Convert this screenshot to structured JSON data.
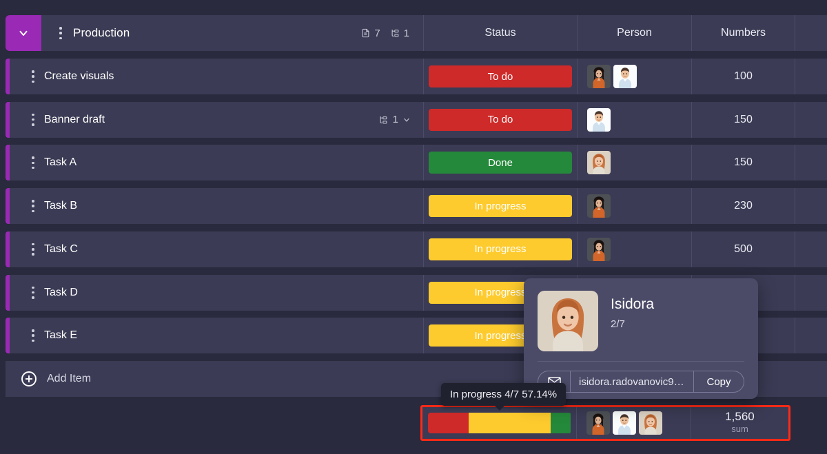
{
  "group": {
    "name": "Production",
    "toggle_icon": "chevron-down-icon",
    "drag_icon": "drag-handle-icon",
    "accent_color": "#9a29b5",
    "counts": {
      "items_icon": "document-icon",
      "items": "7",
      "subitems_icon": "subitem-tree-icon",
      "subitems": "1"
    }
  },
  "columns": {
    "name": "",
    "status": "Status",
    "person": "Person",
    "numbers": "Numbers"
  },
  "status_colors": {
    "To do": "#ce2a29",
    "Done": "#24893a",
    "In progress": "#fdcb2e"
  },
  "rows": [
    {
      "menu_icon": "kebab-menu-icon",
      "name": "Create visuals",
      "status": "To do",
      "avatars": [
        "woman-dark-hair-orange",
        "man-light-shirt"
      ],
      "number": "100",
      "subitems": null
    },
    {
      "menu_icon": "kebab-menu-icon",
      "name": "Banner draft",
      "status": "To do",
      "avatars": [
        "man-light-shirt"
      ],
      "number": "150",
      "subitems": "1",
      "subitems_icon": "subitem-tree-icon",
      "subitems_chevron": "chevron-down-icon"
    },
    {
      "menu_icon": "kebab-menu-icon",
      "name": "Task A",
      "status": "Done",
      "avatars": [
        "woman-red-hair"
      ],
      "number": "150",
      "subitems": null
    },
    {
      "menu_icon": "kebab-menu-icon",
      "name": "Task B",
      "status": "In progress",
      "avatars": [
        "woman-dark-hair-orange"
      ],
      "number": "230",
      "subitems": null
    },
    {
      "menu_icon": "kebab-menu-icon",
      "name": "Task C",
      "status": "In progress",
      "avatars": [
        "woman-dark-hair-orange"
      ],
      "number": "500",
      "subitems": null
    },
    {
      "menu_icon": "kebab-menu-icon",
      "name": "Task D",
      "status": "In progress",
      "avatars": [],
      "number": "",
      "subitems": null
    },
    {
      "menu_icon": "kebab-menu-icon",
      "name": "Task E",
      "status": "In progress",
      "avatars": [],
      "number": "",
      "subitems": null
    }
  ],
  "add_item": {
    "icon": "plus-circle-icon",
    "label": "Add Item"
  },
  "summary": {
    "highlight_color": "#ff2a17",
    "progress_segments": [
      {
        "label": "To do",
        "color": "#ce2a29",
        "percent": 28.57
      },
      {
        "label": "In progress",
        "color": "#fdcb2e",
        "percent": 57.14
      },
      {
        "label": "Done",
        "color": "#24893a",
        "percent": 14.29
      }
    ],
    "avatars": [
      "woman-dark-hair-orange",
      "man-light-shirt",
      "woman-red-hair"
    ],
    "value": "1,560",
    "label": "sum"
  },
  "tooltip": {
    "text": "In progress 4/7 57.14%"
  },
  "person_card": {
    "avatar": "woman-red-hair",
    "name": "Isidora",
    "count": "2/7",
    "mail_icon": "envelope-icon",
    "email": "isidora.radovanovic9…",
    "copy_label": "Copy"
  }
}
